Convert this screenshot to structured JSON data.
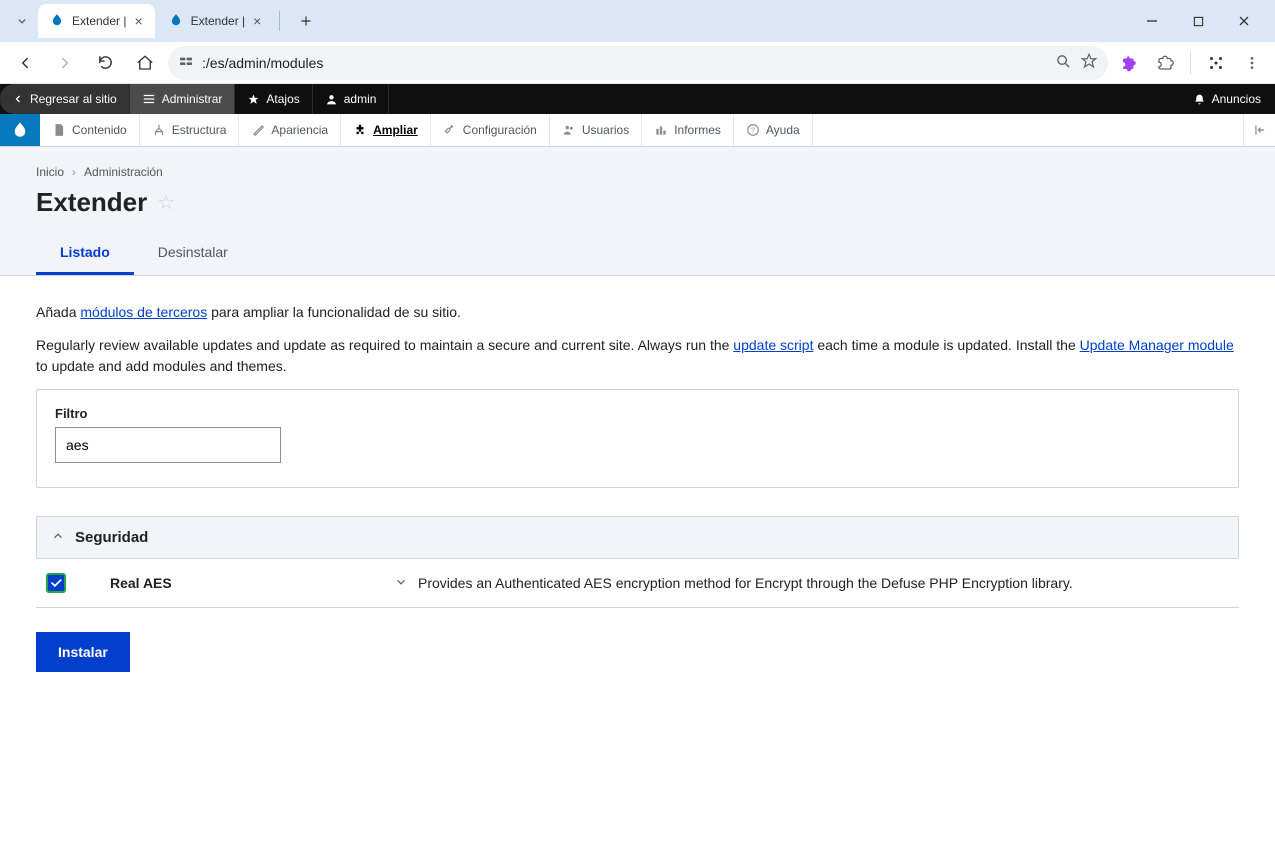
{
  "browser": {
    "tabs": [
      {
        "title": "Extender |",
        "active": true
      },
      {
        "title": "Extender |",
        "active": false
      }
    ],
    "url_path": ":/es/admin/modules"
  },
  "drupalToolbar": {
    "back": "Regresar al sitio",
    "manage": "Administrar",
    "shortcuts": "Atajos",
    "user": "admin",
    "announcements": "Anuncios"
  },
  "adminMenu": {
    "items": [
      "Contenido",
      "Estructura",
      "Apariencia",
      "Ampliar",
      "Configuración",
      "Usuarios",
      "Informes",
      "Ayuda"
    ],
    "activeIndex": 3
  },
  "breadcrumbs": {
    "home": "Inicio",
    "admin": "Administración"
  },
  "pageTitle": "Extender",
  "tabs": {
    "list": "Listado",
    "uninstall": "Desinstalar"
  },
  "intro": {
    "pre1": "Añada ",
    "link1": "módulos de terceros",
    "post1": " para ampliar la funcionalidad de su sitio.",
    "pre2": "Regularly review available updates and update as required to maintain a secure and current site. Always run the ",
    "link2": "update script",
    "mid2": " each time a module is updated. Install the ",
    "link3": "Update Manager module",
    "post2": " to update and add modules and themes."
  },
  "filter": {
    "label": "Filtro",
    "value": "aes"
  },
  "section": {
    "title": "Seguridad",
    "module": {
      "name": "Real AES",
      "desc": "Provides an Authenticated AES encryption method for Encrypt through the Defuse PHP Encryption library."
    }
  },
  "installBtn": "Instalar"
}
